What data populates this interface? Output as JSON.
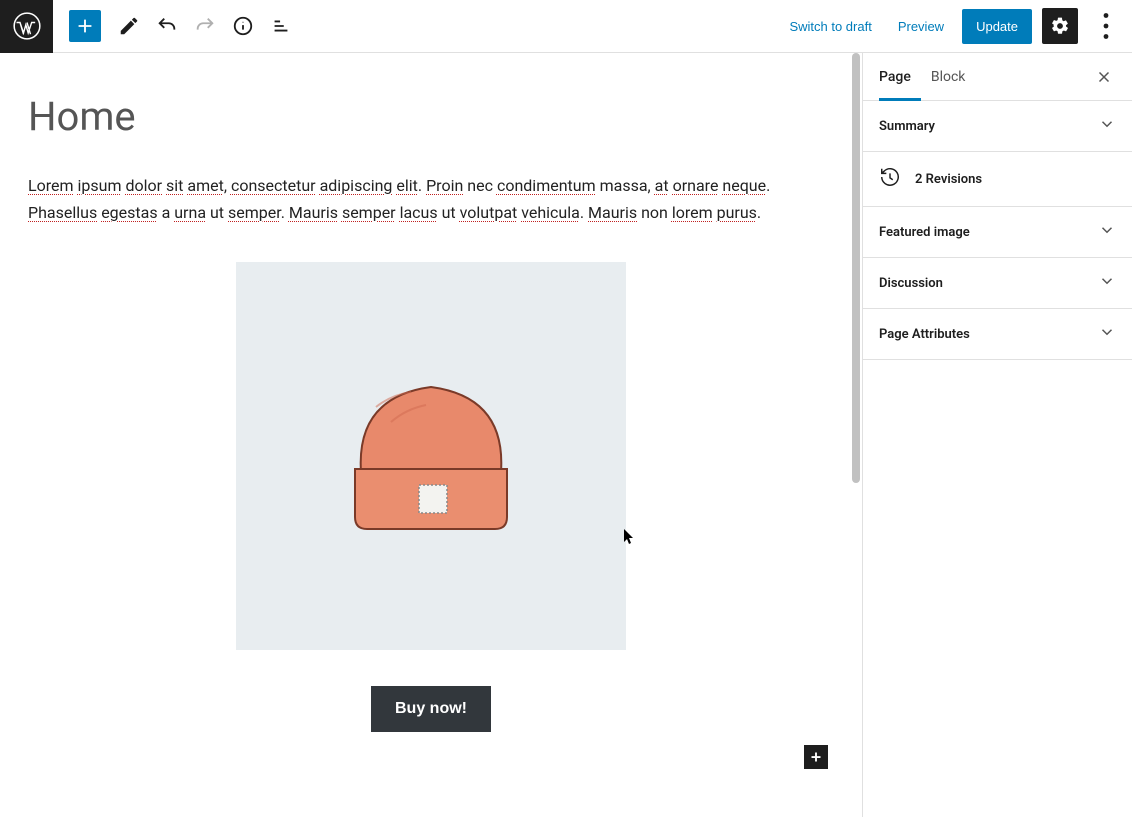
{
  "toolbar": {
    "switch_draft": "Switch to draft",
    "preview": "Preview",
    "update": "Update"
  },
  "page": {
    "title": "Home",
    "paragraph_html": "<span class='sp'>Lorem</span> <span class='sp'>ipsum</span> <span class='sp'>dolor</span> <span class='sp'>sit</span> <span class='sp'>amet</span>, <span class='sp'>consectetur</span> <span class='sp'>adipiscing</span> <span class='sp'>elit</span>. <span class='sp'>Proin</span> nec <span class='sp'>condimentum</span> massa, <span class='sp'>at</span> <span class='sp'>ornare</span> <span class='sp'>neque</span>. <span class='sp'>Phasellus</span> <span class='sp'>egestas</span> a <span class='sp'>urna</span> ut <span class='sp'>semper</span>. <span class='sp'>Mauris</span> <span class='sp'>semper</span> <span class='sp'>lacus</span> ut <span class='sp'>volutpat</span> <span class='sp'>vehicula</span>. <span class='sp'>Mauris</span> non <span class='sp'>lorem</span> <span class='sp'>purus</span>.",
    "buy_label": "Buy now!"
  },
  "sidebar": {
    "tabs": {
      "page": "Page",
      "block": "Block"
    },
    "panels": {
      "summary": "Summary",
      "revisions": "2 Revisions",
      "featured_image": "Featured image",
      "discussion": "Discussion",
      "page_attributes": "Page Attributes"
    }
  }
}
